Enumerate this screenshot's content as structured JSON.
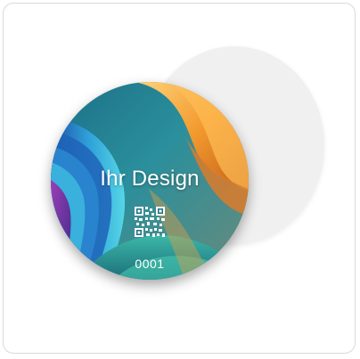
{
  "product": {
    "design_label": "Ihr Design",
    "serial_number": "0001",
    "qr_icon": "qr-code-icon",
    "colors": {
      "back_disc": "#f0f0f0",
      "card_border": "#d9d9d9",
      "art_orange": "#f29a2e",
      "art_teal": "#2fb3b0",
      "art_blue": "#2e79c8",
      "art_purple": "#6a3aa8"
    }
  }
}
